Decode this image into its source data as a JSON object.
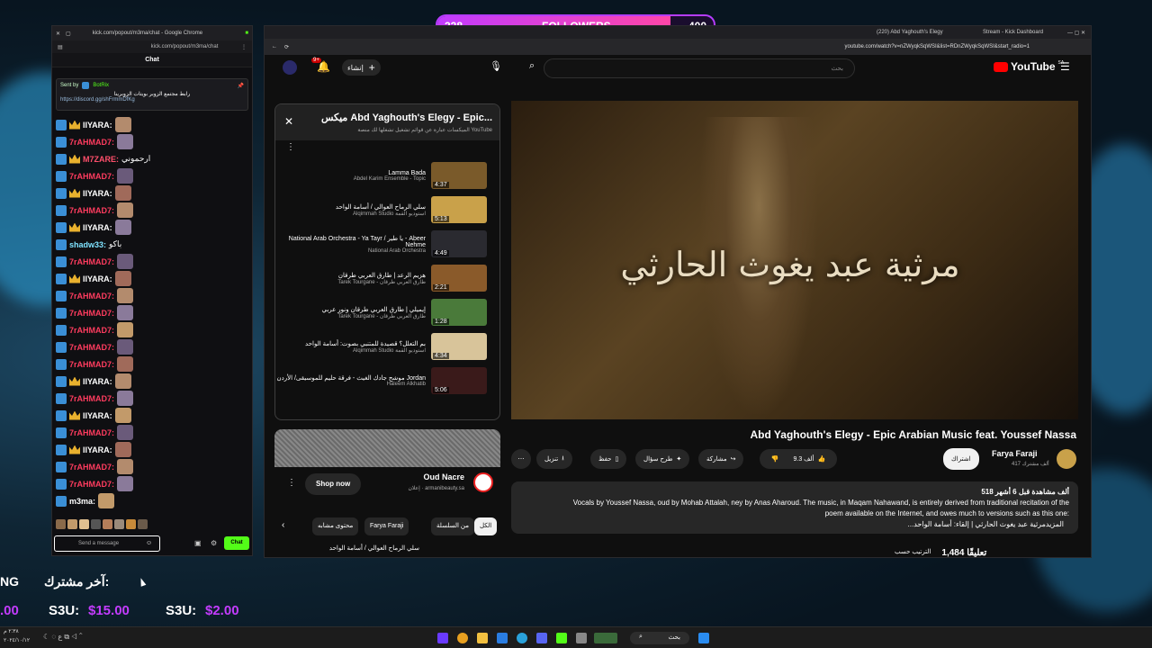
{
  "overlay": {
    "followers_current": "338",
    "followers_label": "FOLLOWERS",
    "followers_goal": "400",
    "followers_progress": 0.845,
    "last_sub_label": "آخر مشترك:",
    "last_sub_prefix": "NG",
    "tips": [
      {
        "amount_left": ".00"
      },
      {
        "user": "S3U:",
        "amount": "$15.00"
      },
      {
        "user": "S3U:",
        "amount": "$2.00"
      }
    ]
  },
  "chat_window": {
    "tab_title": "kick.com/popout/m3ma/chat - Google Chrome",
    "url": "kick.com/popout/m3ma/chat",
    "header": "Chat",
    "pinned": {
      "sent_by": "Sent by",
      "bot": "BotRix",
      "text": "رابط مجتمع الزوبر بويتات الزوبرينا",
      "link": "https://discord.gg/shFrmmDfKg"
    },
    "messages": [
      {
        "user": "IIYARA:",
        "cls": "u-iyara",
        "crown": true,
        "text": ""
      },
      {
        "user": "7rAHMAD7:",
        "cls": "u-ahmad",
        "crown": false,
        "text": ""
      },
      {
        "user": "M7ZARE:",
        "cls": "u-m7z",
        "crown": true,
        "text": "ارحموني"
      },
      {
        "user": "7rAHMAD7:",
        "cls": "u-ahmad",
        "crown": false,
        "text": ""
      },
      {
        "user": "IIYARA:",
        "cls": "u-iyara",
        "crown": true,
        "text": ""
      },
      {
        "user": "7rAHMAD7:",
        "cls": "u-ahmad",
        "crown": false,
        "text": ""
      },
      {
        "user": "IIYARA:",
        "cls": "u-iyara",
        "crown": true,
        "text": ""
      },
      {
        "user": "shadw33:",
        "cls": "u-shadw",
        "crown": false,
        "text": "باكو"
      },
      {
        "user": "7rAHMAD7:",
        "cls": "u-ahmad",
        "crown": false,
        "text": ""
      },
      {
        "user": "IIYARA:",
        "cls": "u-iyara",
        "crown": true,
        "text": ""
      },
      {
        "user": "7rAHMAD7:",
        "cls": "u-ahmad",
        "crown": false,
        "text": ""
      },
      {
        "user": "7rAHMAD7:",
        "cls": "u-ahmad",
        "crown": false,
        "text": ""
      },
      {
        "user": "7rAHMAD7:",
        "cls": "u-ahmad",
        "crown": false,
        "text": ""
      },
      {
        "user": "7rAHMAD7:",
        "cls": "u-ahmad",
        "crown": false,
        "text": ""
      },
      {
        "user": "7rAHMAD7:",
        "cls": "u-ahmad",
        "crown": false,
        "text": ""
      },
      {
        "user": "IIYARA:",
        "cls": "u-iyara",
        "crown": true,
        "text": ""
      },
      {
        "user": "7rAHMAD7:",
        "cls": "u-ahmad",
        "crown": false,
        "text": ""
      },
      {
        "user": "IIYARA:",
        "cls": "u-iyara",
        "crown": true,
        "text": ""
      },
      {
        "user": "7rAHMAD7:",
        "cls": "u-ahmad",
        "crown": false,
        "text": ""
      },
      {
        "user": "IIYARA:",
        "cls": "u-iyara",
        "crown": true,
        "text": ""
      },
      {
        "user": "7rAHMAD7:",
        "cls": "u-ahmad",
        "crown": false,
        "text": ""
      },
      {
        "user": "7rAHMAD7:",
        "cls": "u-ahmad",
        "crown": false,
        "text": ""
      },
      {
        "user": "m3ma:",
        "cls": "u-m3ma",
        "crown": false,
        "text": ""
      }
    ],
    "input_placeholder": "Send a message",
    "chat_button": "Chat"
  },
  "yt_window": {
    "tabs": [
      "(220) Abd Yaghouth's Elegy",
      "Stream - Kick Dashboard"
    ],
    "url": "youtube.com/watch?v=nZWyqkSqWSI&list=RDnZWyqkSqWSI&start_radio=1",
    "create_label": "إنشاء",
    "notif_count": "9+",
    "search_placeholder": "بحث",
    "logo_text": "YouTube",
    "logo_region": "SA",
    "video": {
      "overlay_title": "مرثية عبد يغوث الحارثي",
      "title": "Abd Yaghouth's Elegy - Epic Arabian Music feat. Youssef Nassa",
      "channel": "Farya Faraji",
      "subs": "417 ألف مشترك",
      "subscribe": "اشتراك",
      "likes": "9.3 ألف",
      "share": "مشاركة",
      "ask": "طرح سؤال",
      "save": "حفظ",
      "download": "تنزيل",
      "views": "518 ألف مشاهدة  قبل 6 أشهر",
      "desc_line1": "Vocals by Youssef Nassa, oud by Mohab Attalah, ney by Anas Aharoud. The music, in Maqam Nahawand, is entirely derived from traditional recitation of the",
      "desc_line2": "poem available on the Internet, and owes much to versions such as this one:",
      "desc_line3": "مرثية عبد يغوث الحارثي | إلقاء: أسامة الواحد",
      "desc_more": "...المزيد",
      "comments_count": "1,484 تعليقًا",
      "sort_label": "الترتيب حسب"
    },
    "playlist": {
      "title": "ميكس Abd Yaghouth's Elegy - Epic...",
      "subtitle": "الميكسات عبارة عن قوائم تشغيل تشغلها لك منصة YouTube",
      "items": [
        {
          "title": "Lamma Bada",
          "channel": "Abdel Karim Ensemble - Topic",
          "dur": "4:37",
          "color": "#7a5a2a"
        },
        {
          "title": "سلي الرماح العوالي / أسامة الواحد",
          "channel": "Alqimmah Studio استوديو القمة",
          "dur": "5:13",
          "color": "#c9a14a"
        },
        {
          "title": "National Arab Orchestra - Ya Tayr / يا طير - Abeer Nehme",
          "channel": "National Arab Orchestra",
          "dur": "4:49",
          "color": "#2a2a30"
        },
        {
          "title": "هزيم الرعد | طارق العربي طرقان",
          "channel": "Tarek Tourgane - طارق العربي طرقان",
          "dur": "2:21",
          "color": "#8a5a2a"
        },
        {
          "title": "إيميلي | طارق العربي طرقان ونور عربي",
          "channel": "Tarek Tourgane - طارق العربي طرقان",
          "dur": "1:28",
          "color": "#4a7a3a"
        },
        {
          "title": "بم التعلل؟ قصيدة للمتنبي بصوت: أسامة الواحد",
          "channel": "Alqimmah Studio استوديو القمة",
          "dur": "4:34",
          "color": "#d8c49a"
        },
        {
          "title": "موشح جادك الغيث - فرقة حليم للموسيقى/ الأردن Jordan",
          "channel": "Haleem Alkhatib",
          "dur": "5:06",
          "color": "#3a1a1a"
        }
      ]
    },
    "ad": {
      "name": "Oud Nacre",
      "sponsor": "إعلان · armanibeauty.sa",
      "button": "Shop now"
    },
    "chips": [
      "الكل",
      "من السلسلة",
      "Farya Faraji",
      "محتوى مشابه"
    ],
    "next_item": "سلي الرماح العوالي / أسامة الواحد"
  },
  "taskbar": {
    "search_label": "بحث",
    "time": "٢:٣٨ م",
    "date": "٢٠٢٤/١٠/١٢"
  }
}
